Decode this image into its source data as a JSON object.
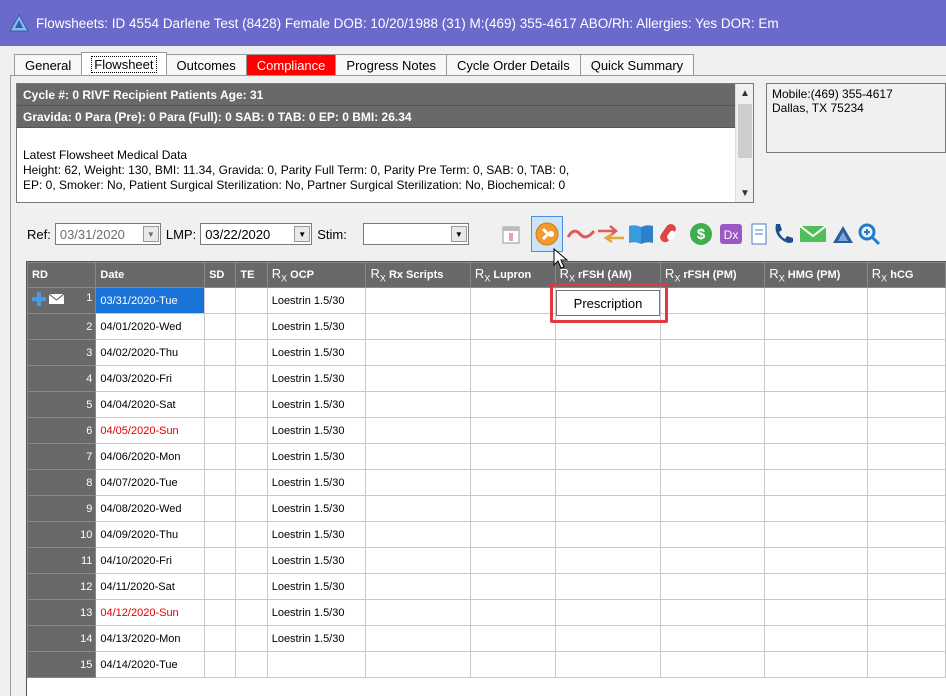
{
  "title_bar": {
    "text": "Flowsheets: ID 4554  Darlene Test (8428)  Female   DOB: 10/20/1988 (31)   M:(469) 355-4617   ABO/Rh:   Allergies: Yes   DOR: Em"
  },
  "tabs": [
    {
      "label": "General"
    },
    {
      "label": "Flowsheet"
    },
    {
      "label": "Outcomes"
    },
    {
      "label": "Compliance"
    },
    {
      "label": "Progress Notes"
    },
    {
      "label": "Cycle Order Details"
    },
    {
      "label": "Quick Summary"
    }
  ],
  "info": {
    "line1": "Cycle #: 0 RIVF Recipient     Patients Age: 31",
    "line2": "Gravida: 0  Para (Pre): 0  Para (Full): 0  SAB: 0  TAB: 0  EP: 0            BMI: 26.34",
    "text1": "Latest Flowsheet Medical Data",
    "text2": "Height: 62, Weight: 130, BMI: 11.34, Gravida: 0, Parity Full Term: 0, Parity Pre Term: 0, SAB: 0, TAB: 0,",
    "text3": "EP: 0, Smoker: No, Patient Surgical Sterilization: No, Partner Surgical Sterilization: No, Biochemical: 0"
  },
  "contact": {
    "mobile": "Mobile:(469) 355-4617",
    "city": "Dallas, TX 75234"
  },
  "controls": {
    "ref_label": "Ref:",
    "ref_value": "03/31/2020",
    "lmp_label": "LMP:",
    "lmp_value": "03/22/2020",
    "stim_label": "Stim:",
    "stim_value": ""
  },
  "toolbar_icons": [
    "calendar-icon",
    "prescription-icon",
    "link-icon",
    "arrows-icon",
    "book-icon",
    "pill-icon",
    "dollar-icon",
    "dx-icon",
    "document-icon",
    "phone-icon",
    "mail-icon",
    "triangle-icon",
    "search-icon"
  ],
  "tooltip": "Prescription",
  "grid": {
    "headers": [
      {
        "rx": false,
        "label": "RD"
      },
      {
        "rx": false,
        "label": "Date"
      },
      {
        "rx": false,
        "label": "SD"
      },
      {
        "rx": false,
        "label": "TE"
      },
      {
        "rx": true,
        "label": "OCP"
      },
      {
        "rx": true,
        "label": "Rx Scripts"
      },
      {
        "rx": true,
        "label": "Lupron"
      },
      {
        "rx": true,
        "label": "rFSH (AM)"
      },
      {
        "rx": true,
        "label": "rFSH (PM)"
      },
      {
        "rx": true,
        "label": "HMG (PM)"
      },
      {
        "rx": true,
        "label": "hCG"
      }
    ],
    "rows": [
      {
        "rd": "1",
        "date": "03/31/2020-Tue",
        "ocp": "Loestrin 1.5/30",
        "sunday": false,
        "selected": true
      },
      {
        "rd": "2",
        "date": "04/01/2020-Wed",
        "ocp": "Loestrin 1.5/30",
        "sunday": false,
        "selected": false
      },
      {
        "rd": "3",
        "date": "04/02/2020-Thu",
        "ocp": "Loestrin 1.5/30",
        "sunday": false,
        "selected": false
      },
      {
        "rd": "4",
        "date": "04/03/2020-Fri",
        "ocp": "Loestrin 1.5/30",
        "sunday": false,
        "selected": false
      },
      {
        "rd": "5",
        "date": "04/04/2020-Sat",
        "ocp": "Loestrin 1.5/30",
        "sunday": false,
        "selected": false
      },
      {
        "rd": "6",
        "date": "04/05/2020-Sun",
        "ocp": "Loestrin 1.5/30",
        "sunday": true,
        "selected": false
      },
      {
        "rd": "7",
        "date": "04/06/2020-Mon",
        "ocp": "Loestrin 1.5/30",
        "sunday": false,
        "selected": false
      },
      {
        "rd": "8",
        "date": "04/07/2020-Tue",
        "ocp": "Loestrin 1.5/30",
        "sunday": false,
        "selected": false
      },
      {
        "rd": "9",
        "date": "04/08/2020-Wed",
        "ocp": "Loestrin 1.5/30",
        "sunday": false,
        "selected": false
      },
      {
        "rd": "10",
        "date": "04/09/2020-Thu",
        "ocp": "Loestrin 1.5/30",
        "sunday": false,
        "selected": false
      },
      {
        "rd": "11",
        "date": "04/10/2020-Fri",
        "ocp": "Loestrin 1.5/30",
        "sunday": false,
        "selected": false
      },
      {
        "rd": "12",
        "date": "04/11/2020-Sat",
        "ocp": "Loestrin 1.5/30",
        "sunday": false,
        "selected": false
      },
      {
        "rd": "13",
        "date": "04/12/2020-Sun",
        "ocp": "Loestrin 1.5/30",
        "sunday": true,
        "selected": false
      },
      {
        "rd": "14",
        "date": "04/13/2020-Mon",
        "ocp": "Loestrin 1.5/30",
        "sunday": false,
        "selected": false
      },
      {
        "rd": "15",
        "date": "04/14/2020-Tue",
        "ocp": "",
        "sunday": false,
        "selected": false
      }
    ]
  },
  "colors": {
    "title_bar": "#6a6acb",
    "header_gray": "#696969",
    "selection": "#1a73d9",
    "sunday_red": "#e00000",
    "compliance_tab": "#ff0000",
    "highlight_red": "#e0383e"
  }
}
